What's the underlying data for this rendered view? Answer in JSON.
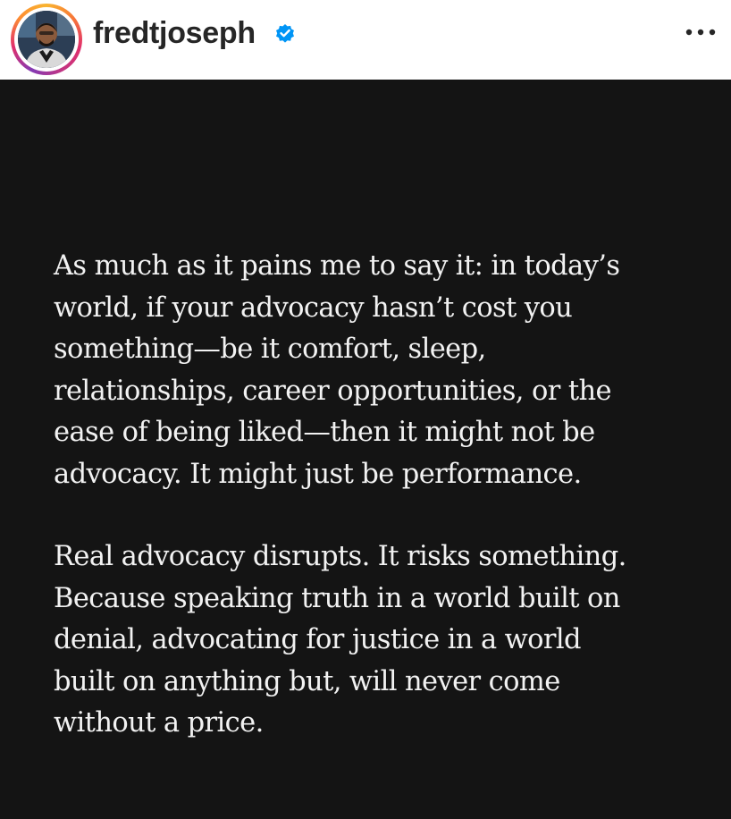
{
  "header": {
    "username": "fredtjoseph",
    "verified_icon": "verified-badge-icon",
    "more_icon": "more-options-icon",
    "avatar_icon": "profile-avatar"
  },
  "post": {
    "paragraphs": [
      {
        "lines": [
          "As much as it pains me to say it: in today’s",
          "world, if your advocacy hasn’t cost you",
          "something—be it comfort, sleep,",
          "relationships, career opportunities, or the",
          "ease of being liked—then it might not be",
          "advocacy. It might just be performance."
        ]
      },
      {
        "lines": [
          "Real advocacy disrupts. It risks something.",
          "Because speaking truth in a world built on",
          "denial, advocating for justice in a world",
          "built on anything but, will never come",
          "without a price."
        ]
      }
    ]
  },
  "colors": {
    "post_background": "#141414",
    "text": "#f2f2f2",
    "verified_blue": "#0095f6",
    "username": "#262626"
  }
}
